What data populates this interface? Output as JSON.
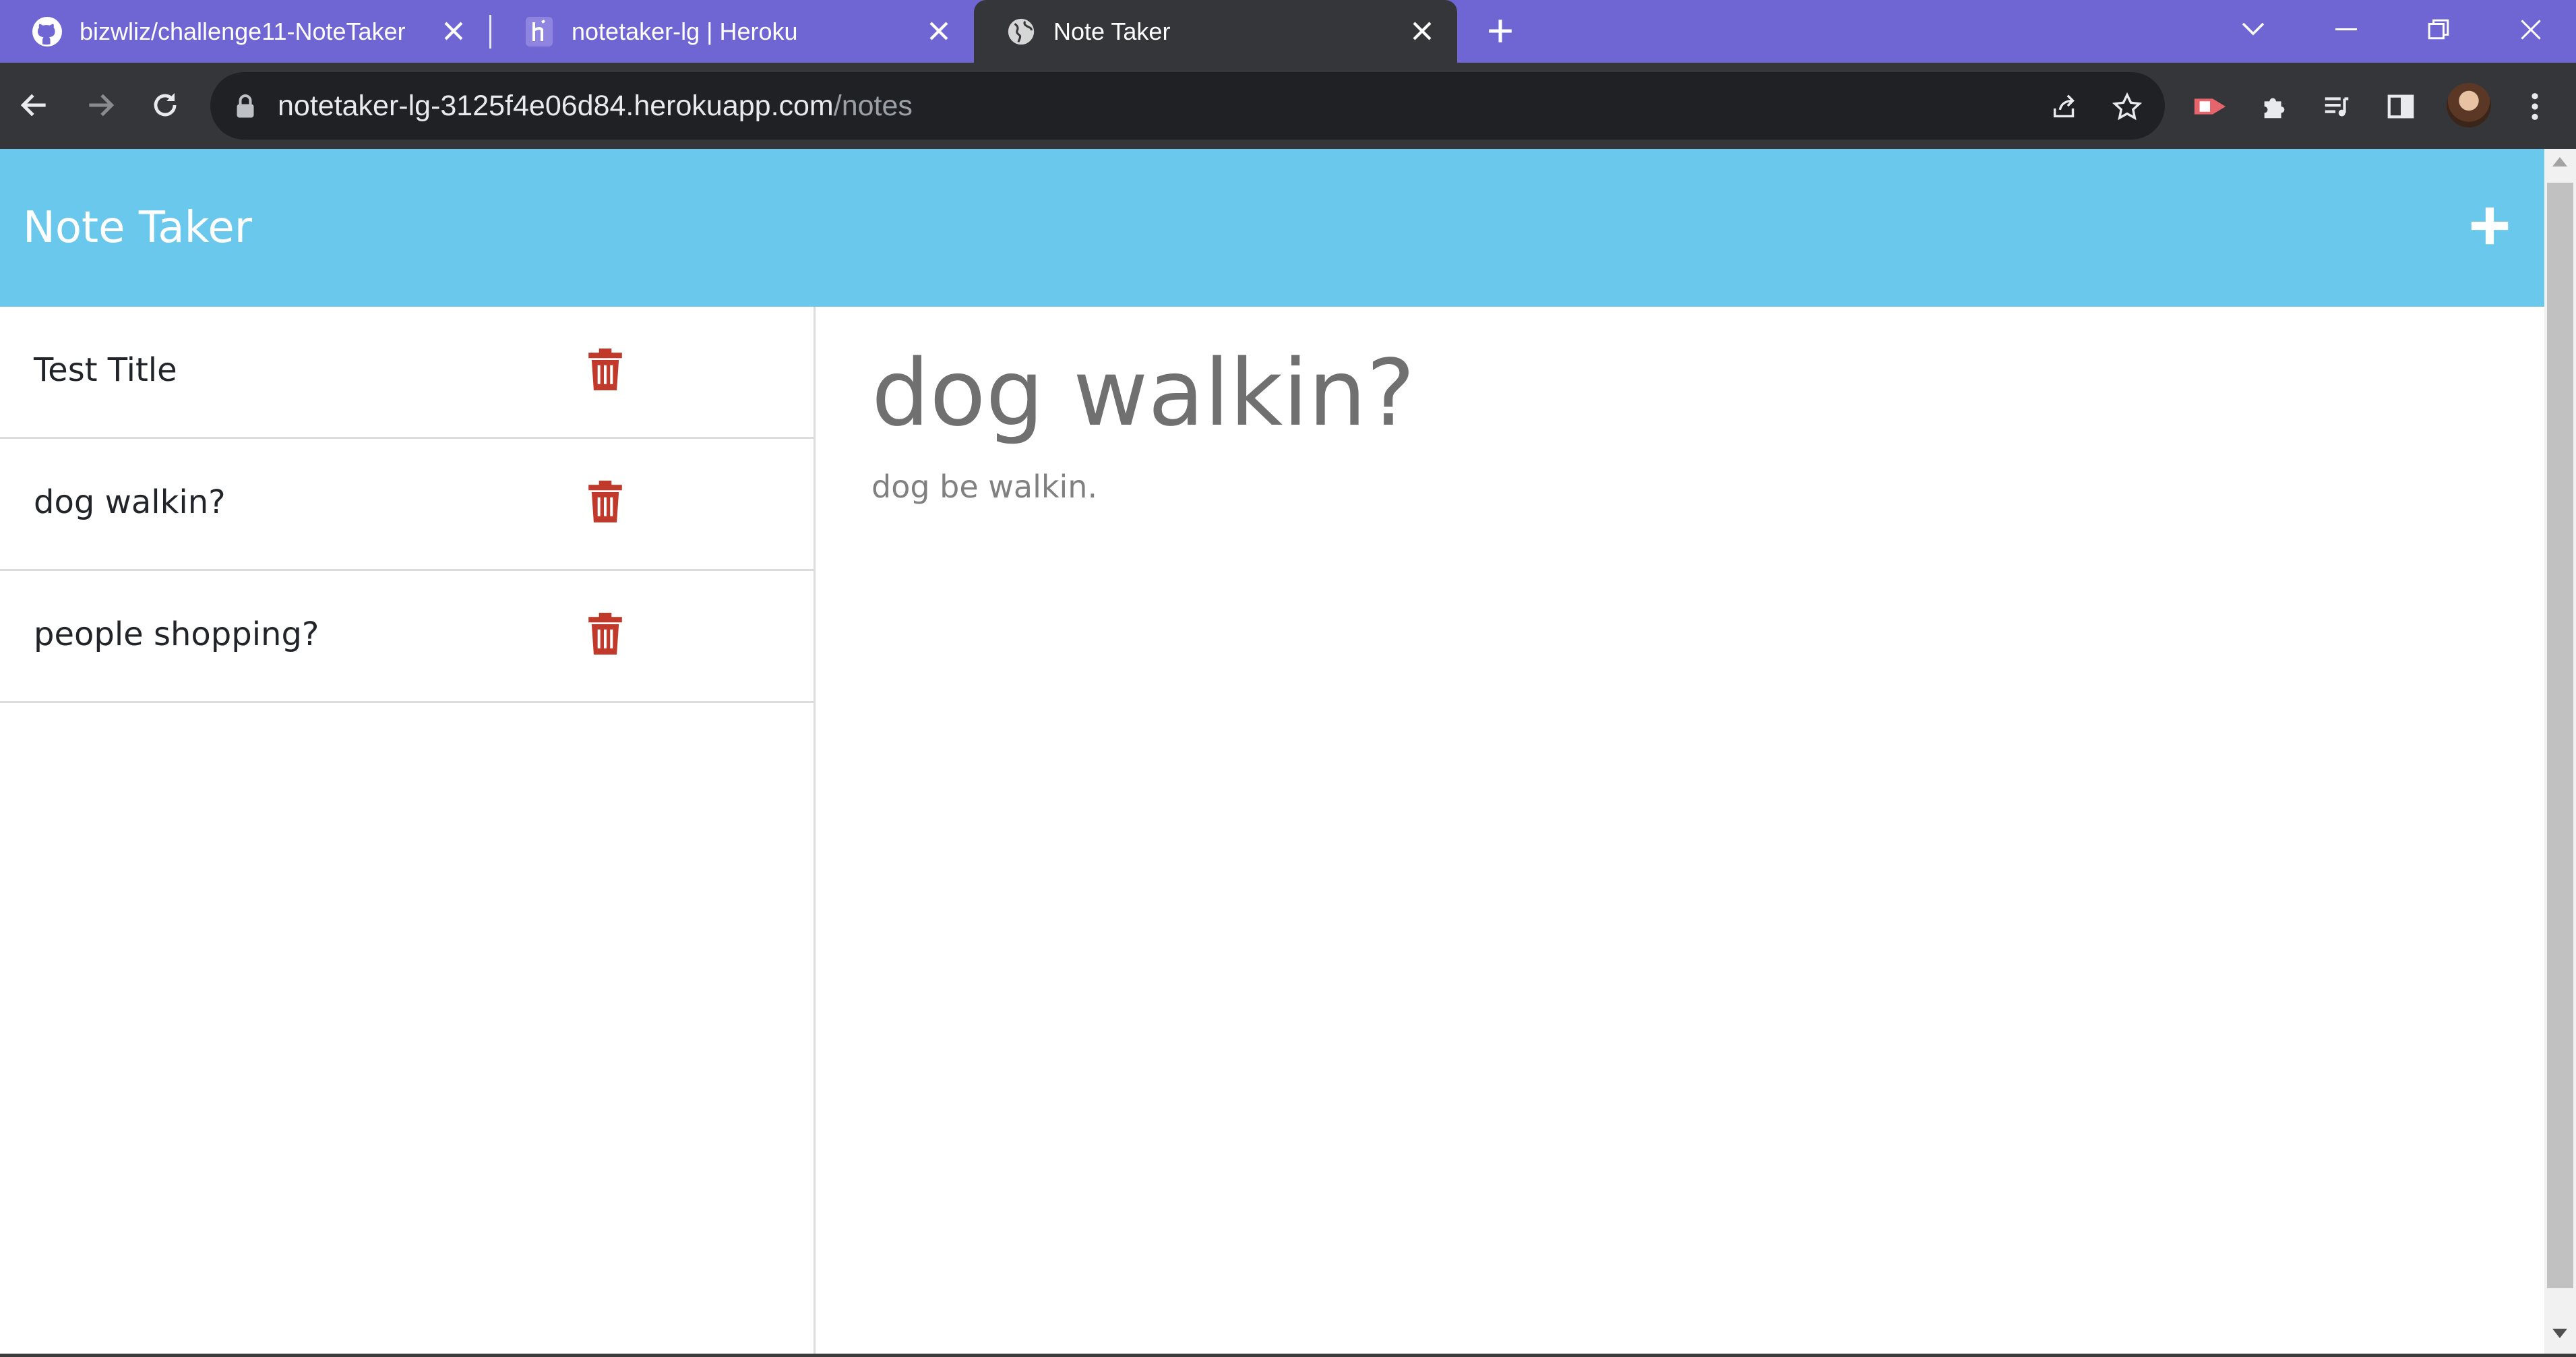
{
  "browser": {
    "tabs": [
      {
        "title": "bizwliz/challenge11-NoteTaker",
        "icon": "github-icon",
        "active": false
      },
      {
        "title": "notetaker-lg | Heroku",
        "icon": "heroku-icon",
        "active": false
      },
      {
        "title": "Note Taker",
        "icon": "globe-icon",
        "active": true
      }
    ],
    "url_host": "notetaker-lg-3125f4e06d84.herokuapp.com",
    "url_path": "/notes",
    "colors": {
      "tabstrip": "#6f66d3",
      "toolbar": "#35363a",
      "omnibox": "#202124"
    }
  },
  "app": {
    "brand": "Note Taker",
    "header_color": "#6bc8ed",
    "new_note_icon": "plus-icon",
    "delete_icon": "trash-icon",
    "delete_color": "#c0392b",
    "notes": [
      {
        "title": "Test Title"
      },
      {
        "title": "dog walkin?"
      },
      {
        "title": "people shopping?"
      }
    ],
    "active_note": {
      "title": "dog walkin?",
      "text": "dog be walkin."
    }
  }
}
